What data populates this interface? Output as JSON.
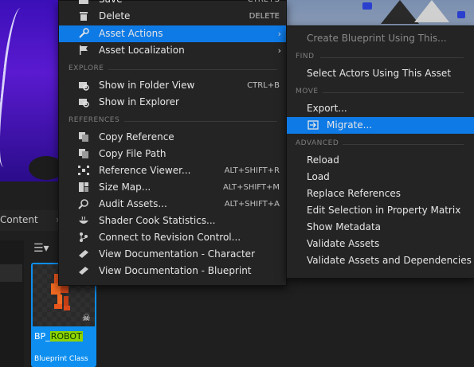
{
  "colors": {
    "menu_bg": "#242424",
    "highlight": "#0e7ae6",
    "asset_tile": "#0e8ff0",
    "name_highlight": "#8fd400"
  },
  "content_browser": {
    "tab_label": "Content",
    "tab_separator": "›",
    "filter_icon": "filter-icon",
    "asset": {
      "name_prefix": "BP_",
      "name_highlight": "ROBOT",
      "type": "Blueprint Class"
    }
  },
  "context_menu": {
    "items_top": [
      {
        "label": "Save",
        "shortcut": "CTRL+S",
        "icon": "save-icon"
      },
      {
        "label": "Delete",
        "shortcut": "DELETE",
        "icon": "trash-icon"
      },
      {
        "label": "Asset Actions",
        "icon": "wrench-icon",
        "submenu": true
      },
      {
        "label": "Asset Localization",
        "icon": "flag-icon",
        "submenu": true
      }
    ],
    "sections": {
      "explore": "EXPLORE",
      "references": "REFERENCES"
    },
    "explore_items": [
      {
        "label": "Show in Folder View",
        "shortcut": "CTRL+B",
        "icon": "folder-search-icon"
      },
      {
        "label": "Show in Explorer",
        "icon": "folder-search-icon"
      }
    ],
    "reference_items": [
      {
        "label": "Copy Reference",
        "icon": "copy-icon"
      },
      {
        "label": "Copy File Path",
        "icon": "copy-icon"
      },
      {
        "label": "Reference Viewer...",
        "shortcut": "ALT+SHIFT+R",
        "icon": "graph-icon"
      },
      {
        "label": "Size Map...",
        "shortcut": "ALT+SHIFT+M",
        "icon": "grid-icon"
      },
      {
        "label": "Audit Assets...",
        "shortcut": "ALT+SHIFT+A",
        "icon": "magnifier-icon"
      },
      {
        "label": "Shader Cook Statistics...",
        "icon": "bowl-icon"
      },
      {
        "label": "Connect to Revision Control...",
        "icon": "branch-icon"
      },
      {
        "label": "View Documentation - Character",
        "icon": "book-icon"
      },
      {
        "label": "View Documentation - Blueprint",
        "icon": "book-icon"
      }
    ]
  },
  "submenu": {
    "create_blueprint": "Create Blueprint Using This...",
    "sections": {
      "find": "FIND",
      "move": "MOVE",
      "advanced": "ADVANCED"
    },
    "find_items": [
      "Select Actors Using This Asset"
    ],
    "move_items": [
      "Export...",
      "Migrate..."
    ],
    "advanced_items": [
      "Reload",
      "Load",
      "Replace References",
      "Edit Selection in Property Matrix",
      "Show Metadata",
      "Validate Assets",
      "Validate Assets and Dependencies"
    ]
  }
}
